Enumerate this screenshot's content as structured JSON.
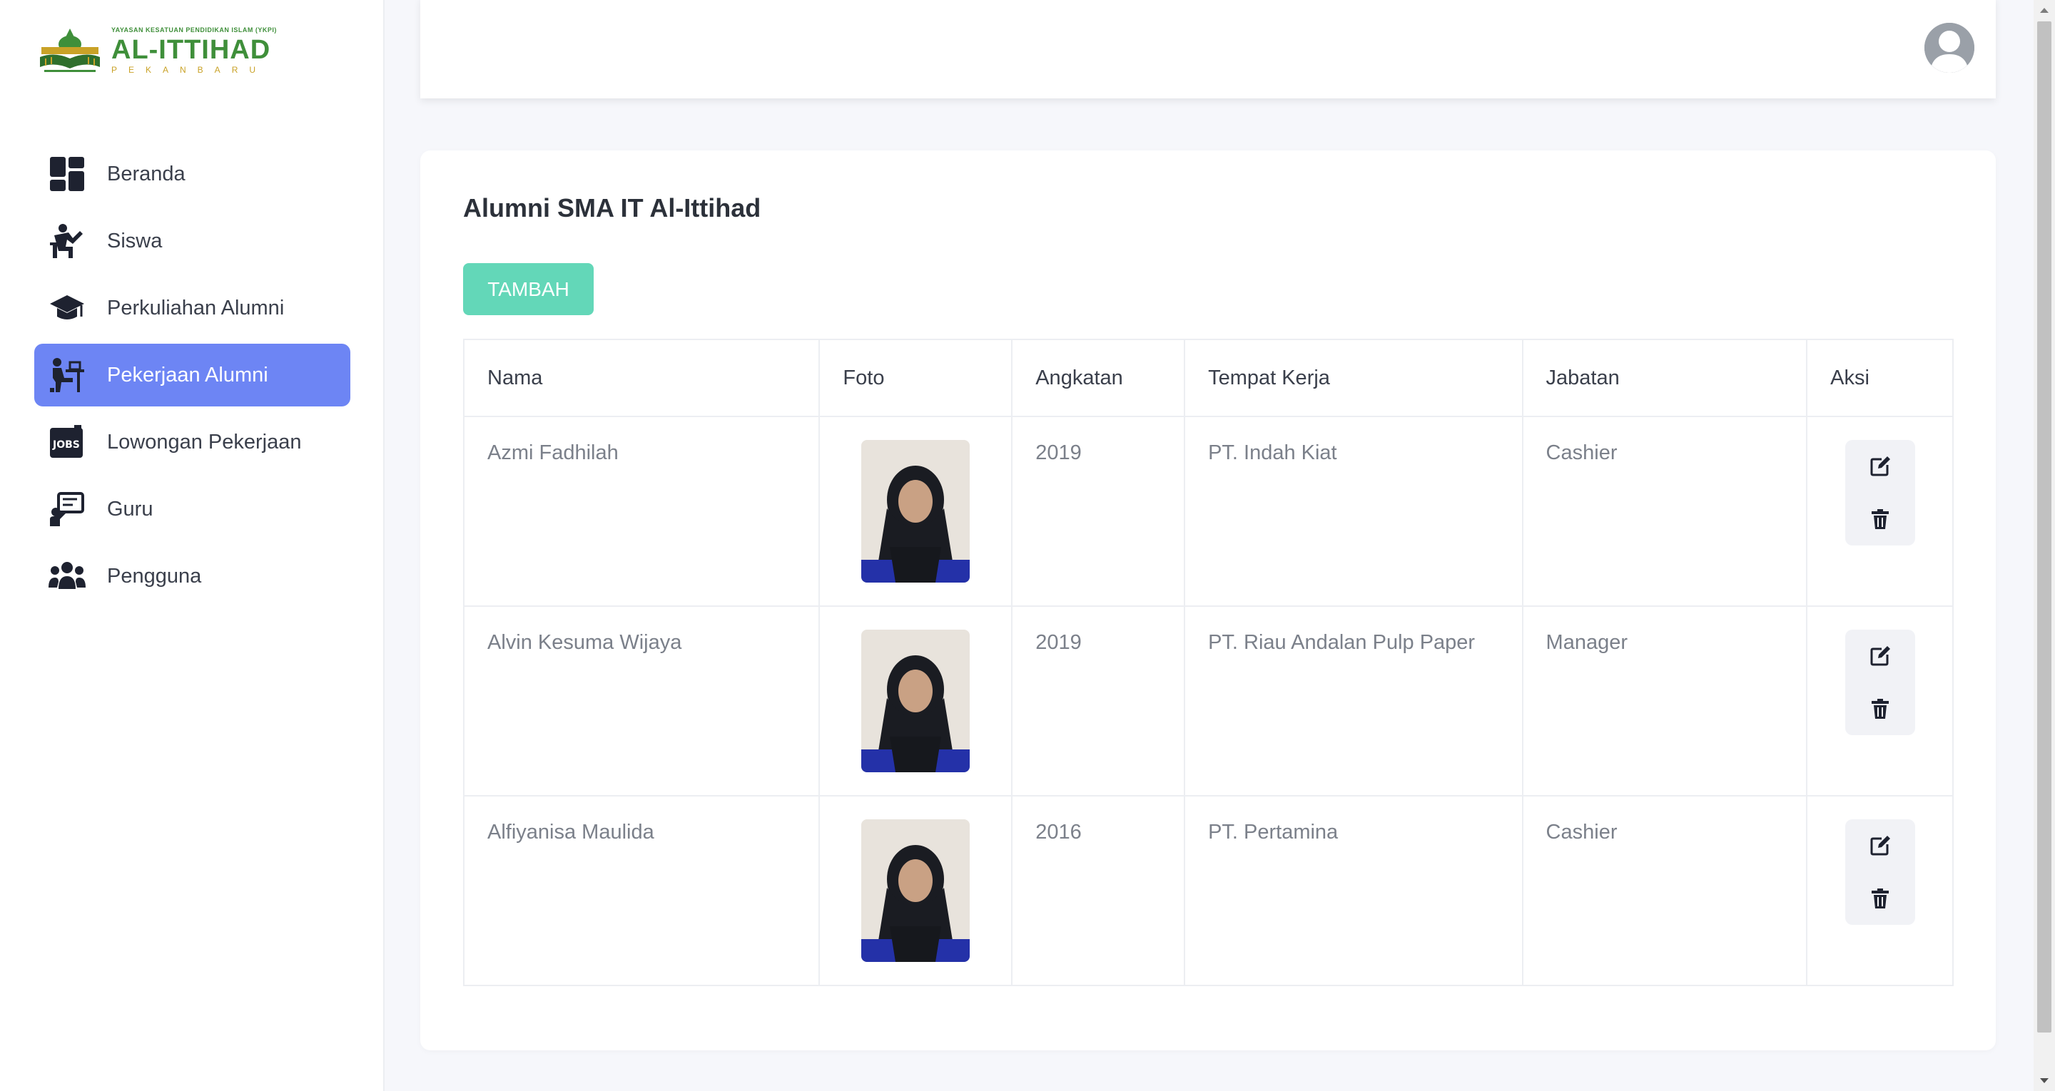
{
  "brand": {
    "top_line": "YAYASAN KESATUAN PENDIDIKAN ISLAM (YKPI)",
    "name": "AL-ITTIHAD",
    "city": "PEKANBARU"
  },
  "sidebar": {
    "items": [
      {
        "label": "Beranda",
        "icon": "dashboard-icon",
        "active": false
      },
      {
        "label": "Siswa",
        "icon": "student-desk-icon",
        "active": false
      },
      {
        "label": "Perkuliahan Alumni",
        "icon": "graduation-cap-icon",
        "active": false
      },
      {
        "label": "Pekerjaan Alumni",
        "icon": "worker-desk-icon",
        "active": true
      },
      {
        "label": "Lowongan Pekerjaan",
        "icon": "jobs-icon",
        "active": false
      },
      {
        "label": "Guru",
        "icon": "teacher-board-icon",
        "active": false
      },
      {
        "label": "Pengguna",
        "icon": "users-group-icon",
        "active": false
      }
    ]
  },
  "header": {
    "avatar": "user-avatar-icon"
  },
  "main": {
    "title": "Alumni SMA IT Al-Ittihad",
    "add_label": "TAMBAH",
    "columns": [
      "Nama",
      "Foto",
      "Angkatan",
      "Tempat Kerja",
      "Jabatan",
      "Aksi"
    ],
    "rows": [
      {
        "nama": "Azmi Fadhilah",
        "angkatan": "2019",
        "tempat_kerja": "PT. Indah Kiat",
        "jabatan": "Cashier"
      },
      {
        "nama": "Alvin Kesuma Wijaya",
        "angkatan": "2019",
        "tempat_kerja": "PT. Riau Andalan Pulp Paper",
        "jabatan": "Manager"
      },
      {
        "nama": "Alfiyanisa Maulida",
        "angkatan": "2016",
        "tempat_kerja": "PT. Pertamina",
        "jabatan": "Cashier"
      }
    ]
  },
  "colors": {
    "accent": "#6d85f4",
    "add_button": "#63d7b8",
    "brand_green": "#3f8f3a",
    "brand_gold": "#c9a227"
  }
}
